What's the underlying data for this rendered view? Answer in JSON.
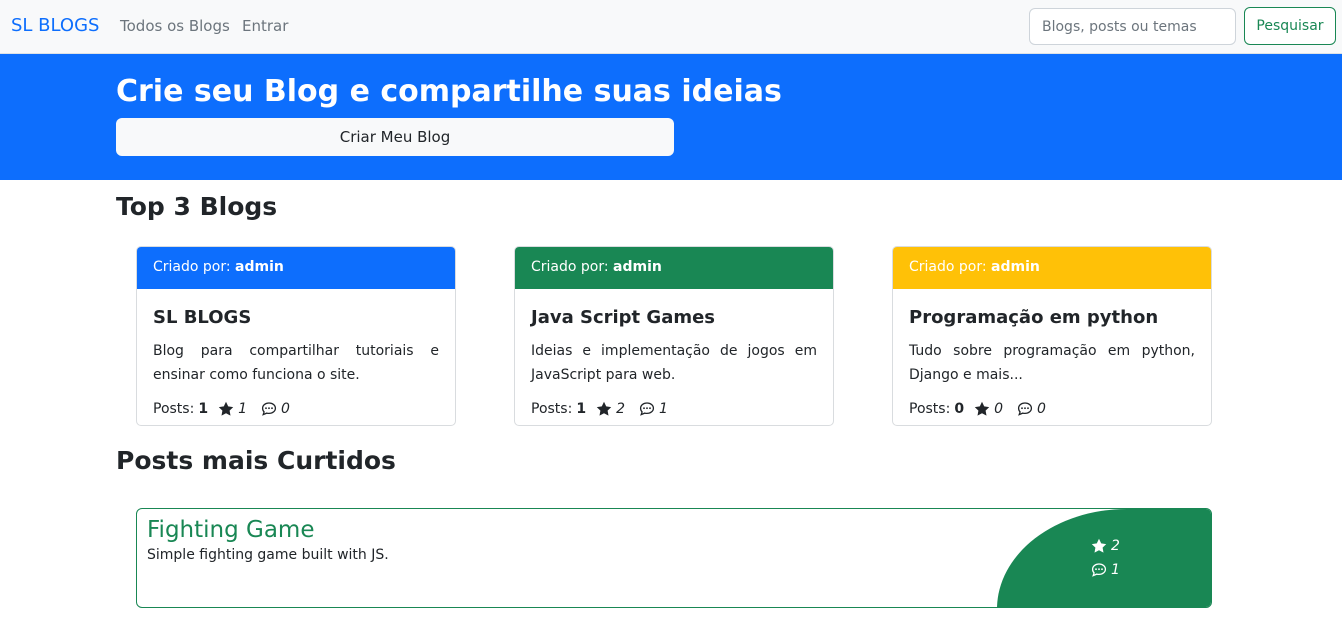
{
  "navbar": {
    "brand": "SL BLOGS",
    "links": [
      "Todos os Blogs",
      "Entrar"
    ],
    "search_placeholder": "Blogs, posts ou temas",
    "search_button": "Pesquisar"
  },
  "hero": {
    "title": "Crie seu Blog e compartilhe suas ideias",
    "button": "Criar Meu Blog"
  },
  "sections": {
    "top_blogs": "Top 3 Blogs",
    "top_posts": "Posts mais Curtidos"
  },
  "colors": {
    "primary": "#0d6efd",
    "success": "#198754",
    "warning": "#ffc107"
  },
  "blogs": [
    {
      "created_by_label": "Criado por:",
      "author": "admin",
      "title": "SL BLOGS",
      "description": "Blog para compartilhar tutoriais e ensinar como funciona o site.",
      "posts_label": "Posts:",
      "posts": "1",
      "stars": "1",
      "comments": "0",
      "header_color": "#0d6efd"
    },
    {
      "created_by_label": "Criado por:",
      "author": "admin",
      "title": "Java Script Games",
      "description": "Ideias e implementação de jogos em JavaScript para web.",
      "posts_label": "Posts:",
      "posts": "1",
      "stars": "2",
      "comments": "1",
      "header_color": "#198754"
    },
    {
      "created_by_label": "Criado por:",
      "author": "admin",
      "title": "Programação em python",
      "description": "Tudo sobre programação em python, Django e mais...",
      "posts_label": "Posts:",
      "posts": "0",
      "stars": "0",
      "comments": "0",
      "header_color": "#ffc107"
    }
  ],
  "posts": [
    {
      "title": "Fighting Game",
      "description": "Simple fighting game built with JS.",
      "stars": "2",
      "comments": "1"
    }
  ],
  "icons": {
    "star": "star-icon",
    "comment": "chat-icon"
  }
}
